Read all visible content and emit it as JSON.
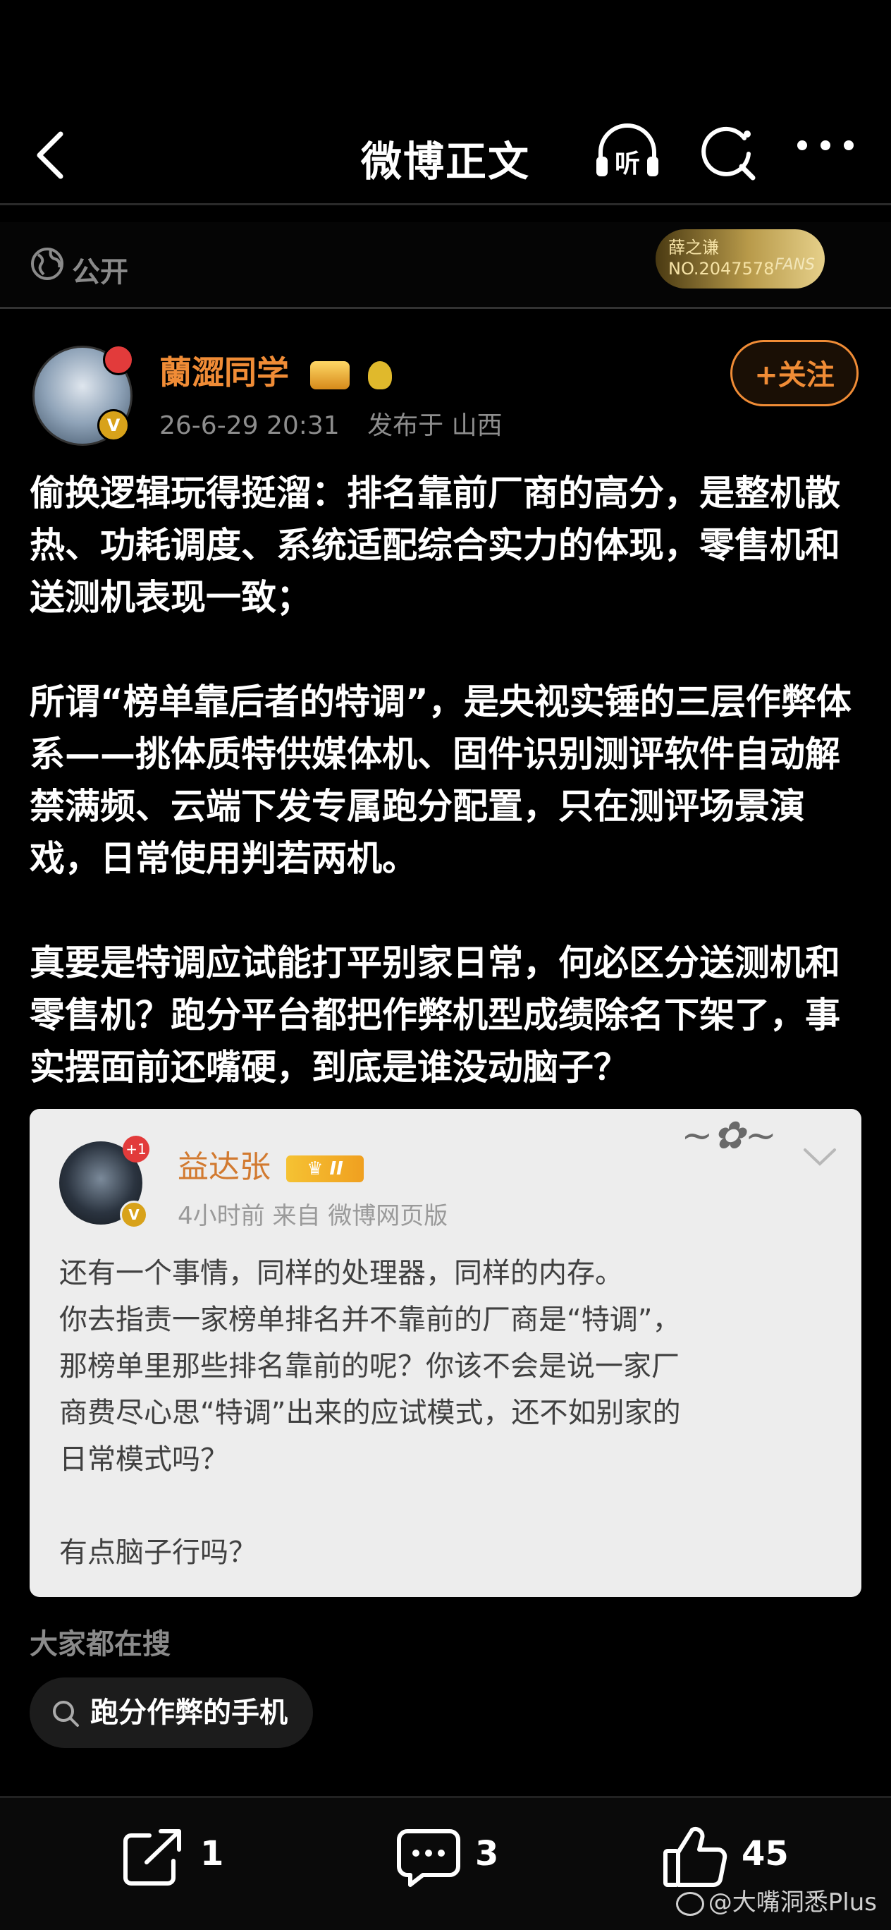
{
  "header": {
    "title": "微博正文",
    "icons": [
      "back-arrow-icon",
      "listen-icon",
      "search-icon",
      "more-icon"
    ],
    "listen_label": "听"
  },
  "visibility": {
    "label": "公开",
    "fan_badge": {
      "name": "薛之谦",
      "number": "NO.2047578",
      "tag": "FANS"
    }
  },
  "author": {
    "name": "蘭澀同学",
    "timestamp": "26-6-29 20:31",
    "location": "发布于 山西",
    "follow_label": "+关注"
  },
  "post": {
    "paragraphs": [
      "偷换逻辑玩得挺溜：排名靠前厂商的高分，是整机散热、功耗调度、系统适配综合实力的体现，零售机和送测机表现一致；",
      "所谓“榜单靠后者的特调”，是央视实锤的三层作弊体系——挑体质特供媒体机、固件识别测评软件自动解禁满频、云端下发专属跑分配置，只在测评场景演戏，日常使用判若两机。",
      "真要是特调应试能打平别家日常，何必区分送测机和零售机？跑分平台都把作弊机型成绩除名下架了，事实摆面前还嘴硬，到底是谁没动脑子？"
    ]
  },
  "quoted": {
    "name": "益达张",
    "badge_count": "+1",
    "meta": "4小时前  来自 微博网页版",
    "lines": [
      "还有一个事情，同样的处理器，同样的内存。",
      "你去指责一家榜单排名并不靠前的厂商是“特调”，",
      "那榜单里那些排名靠前的呢？你该不会是说一家厂",
      "商费尽心思“特调”出来的应试模式，还不如别家的",
      "日常模式吗？",
      "",
      "有点脑子行吗？"
    ]
  },
  "search": {
    "title": "大家都在搜",
    "chip": "跑分作弊的手机"
  },
  "footer": {
    "share_count": "1",
    "comment_count": "3",
    "like_count": "45",
    "watermark": "@大嘴洞悉Plus"
  },
  "colors": {
    "accent": "#f08c36",
    "background": "#000000",
    "quote_bg": "#ededed"
  }
}
